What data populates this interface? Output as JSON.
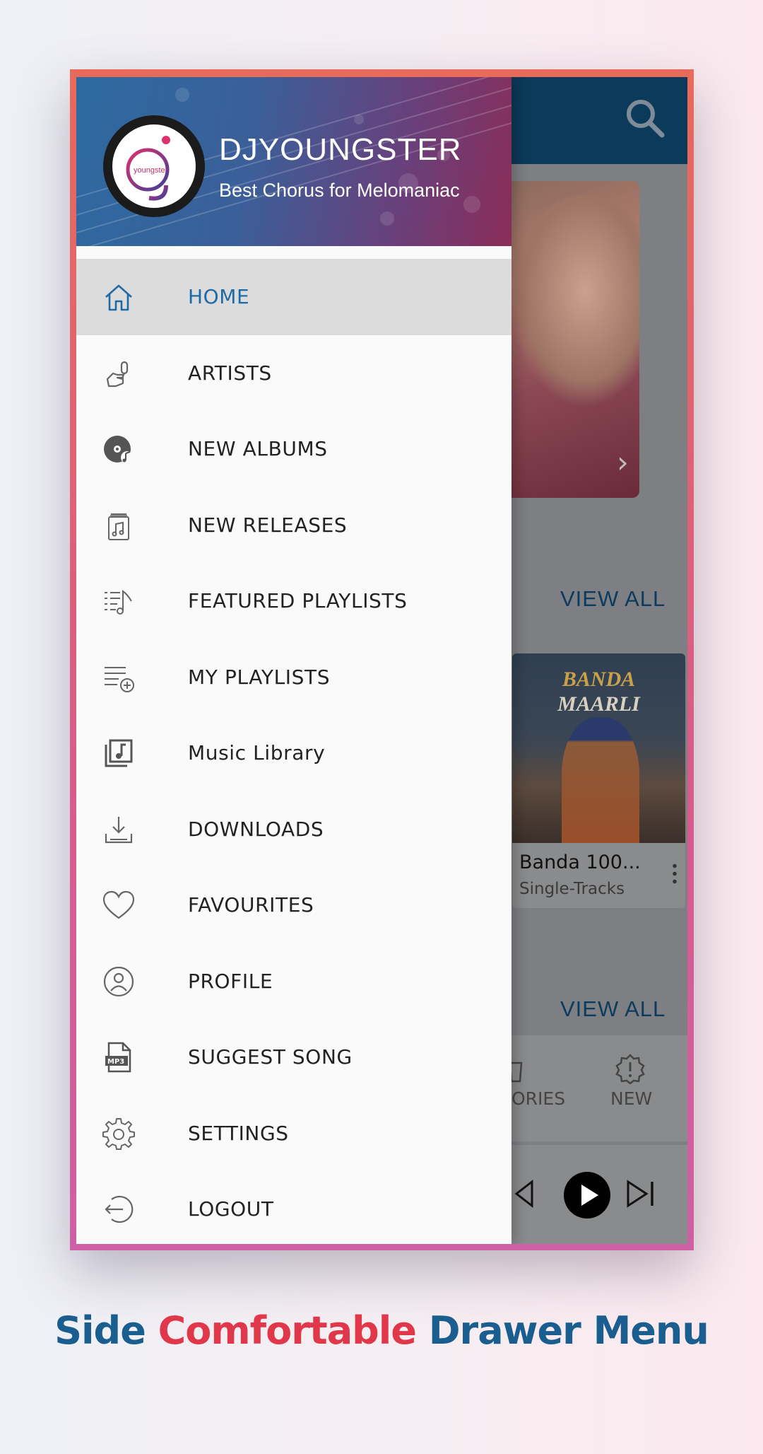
{
  "drawer": {
    "brand": "DJYOUNGSTER",
    "tagline": "Best Chorus for Melomaniac",
    "logo_text": "youngster",
    "items": [
      {
        "label": "HOME",
        "icon": "home-icon",
        "active": true
      },
      {
        "label": "ARTISTS",
        "icon": "microphone-hand-icon"
      },
      {
        "label": "NEW ALBUMS",
        "icon": "vinyl-disc-icon"
      },
      {
        "label": "NEW RELEASES",
        "icon": "music-box-icon"
      },
      {
        "label": "FEATURED PLAYLISTS",
        "icon": "playlist-note-icon"
      },
      {
        "label": "MY PLAYLISTS",
        "icon": "playlist-add-icon"
      },
      {
        "label": "Music Library",
        "icon": "music-library-icon"
      },
      {
        "label": "DOWNLOADS",
        "icon": "download-icon"
      },
      {
        "label": "FAVOURITES",
        "icon": "heart-icon"
      },
      {
        "label": "PROFILE",
        "icon": "profile-icon"
      },
      {
        "label": "SUGGEST SONG",
        "icon": "mp3-file-icon"
      },
      {
        "label": "SETTINGS",
        "icon": "gear-icon"
      },
      {
        "label": "LOGOUT",
        "icon": "logout-icon"
      }
    ]
  },
  "background": {
    "view_all_1": "VIEW ALL",
    "view_all_2": "VIEW ALL",
    "card": {
      "poster_line1": "BANDA",
      "poster_line2": "MAARLI",
      "title": "Banda 100...",
      "subtitle": "Single-Tracks"
    },
    "tabs": [
      "ORIES",
      "NEW"
    ]
  },
  "caption": {
    "word1": "Side",
    "word2": "Comfortable",
    "word3": "Drawer Menu"
  },
  "colors": {
    "frame_top": "#e86a5a",
    "frame_bottom": "#cf5fa6",
    "active_text": "#1f6aa5",
    "caption_blue": "#1a5d8f",
    "caption_red": "#e1374a"
  }
}
